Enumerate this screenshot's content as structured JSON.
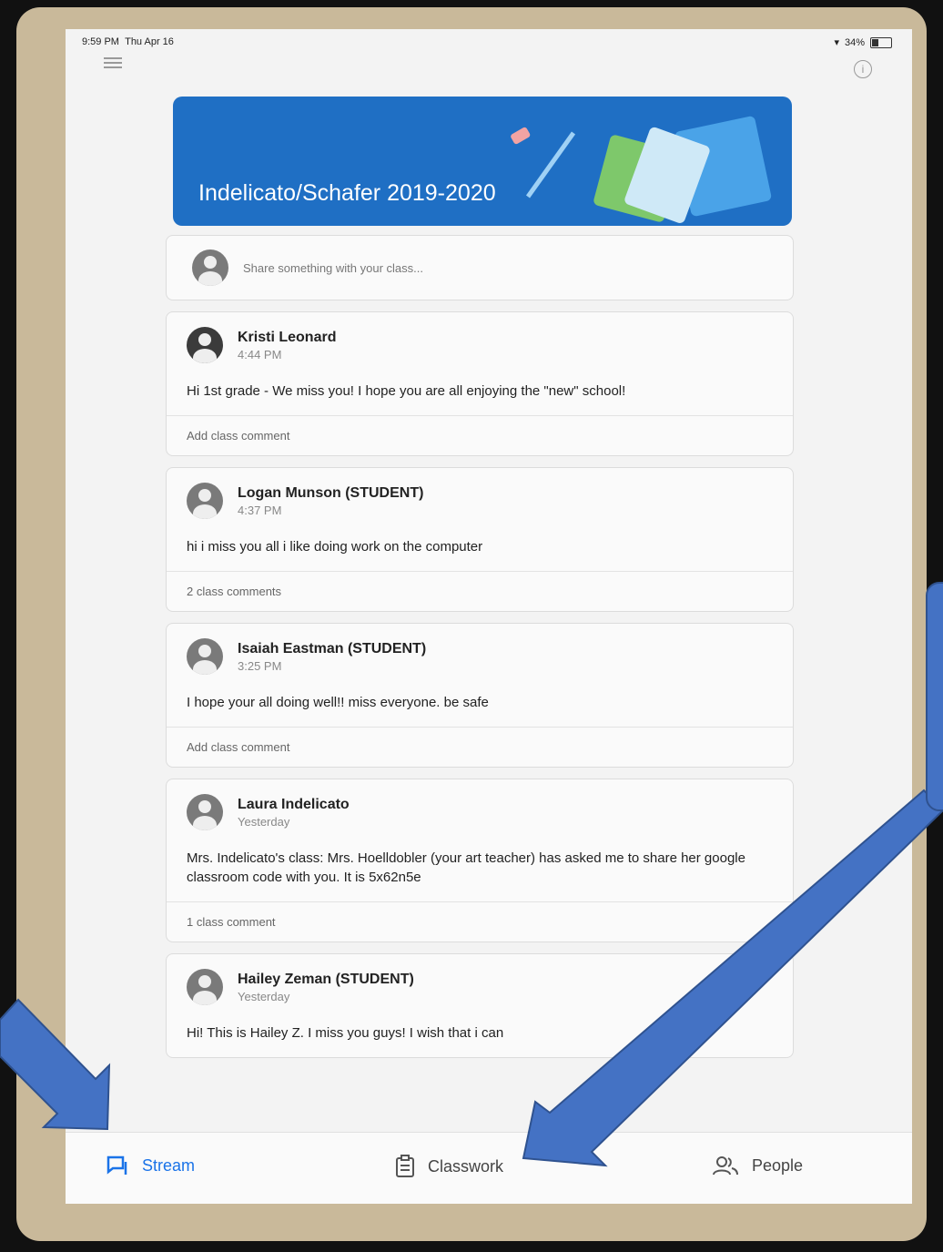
{
  "status": {
    "time": "9:59 PM",
    "date": "Thu Apr 16",
    "battery": "34%",
    "battery_level": 0.34
  },
  "banner": {
    "title": "Indelicato/Schafer 2019-2020",
    "color": "#1f6fc4"
  },
  "share": {
    "placeholder": "Share something with your class..."
  },
  "posts": [
    {
      "author": "Kristi Leonard",
      "time": "4:44 PM",
      "body": "Hi 1st grade - We miss you! I hope you are all enjoying the \"new\" school!",
      "comments": "Add class comment"
    },
    {
      "author": "Logan Munson (STUDENT)",
      "time": "4:37 PM",
      "body": "hi i miss you all i like doing work on the computer",
      "comments": "2 class comments"
    },
    {
      "author": "Isaiah Eastman (STUDENT)",
      "time": "3:25 PM",
      "body": "I hope your all doing well!!  miss everyone. be safe",
      "comments": "Add class comment"
    },
    {
      "author": "Laura Indelicato",
      "time": "Yesterday",
      "body": "Mrs. Indelicato's class:  Mrs. Hoelldobler  (your art teacher) has asked me to share her google classroom code with you.  It is  5x62n5e",
      "comments": "1 class comment"
    },
    {
      "author": "Hailey Zeman (STUDENT)",
      "time": "Yesterday",
      "body": "Hi! This is Hailey Z. I miss you guys! I wish that i can"
    }
  ],
  "nav": {
    "stream": "Stream",
    "classwork": "Classwork",
    "people": "People"
  },
  "colors": {
    "accent": "#1a73e8",
    "arrow": "#4472c4"
  }
}
